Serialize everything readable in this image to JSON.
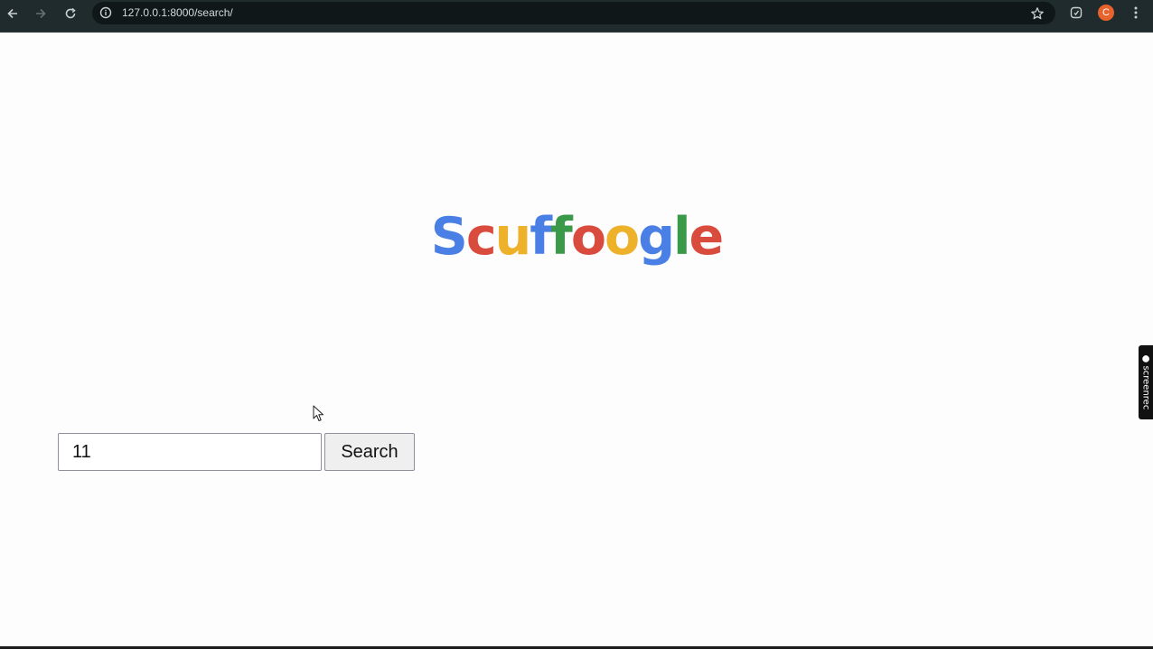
{
  "browser": {
    "url": "127.0.0.1:8000/search/",
    "avatar_letter": "C"
  },
  "logo": {
    "letters": [
      "S",
      "c",
      "u",
      "f",
      "f",
      "o",
      "o",
      "g",
      "l",
      "e"
    ],
    "colors": [
      "#4a7fe6",
      "#d94b3c",
      "#edb22a",
      "#4a7fe6",
      "#3a9a49",
      "#d94b3c",
      "#edb22a",
      "#4a7fe6",
      "#3a9a49",
      "#d94b3c"
    ]
  },
  "search": {
    "value": "11",
    "button_label": "Search"
  },
  "screenrec": {
    "label": "● screenrec"
  }
}
